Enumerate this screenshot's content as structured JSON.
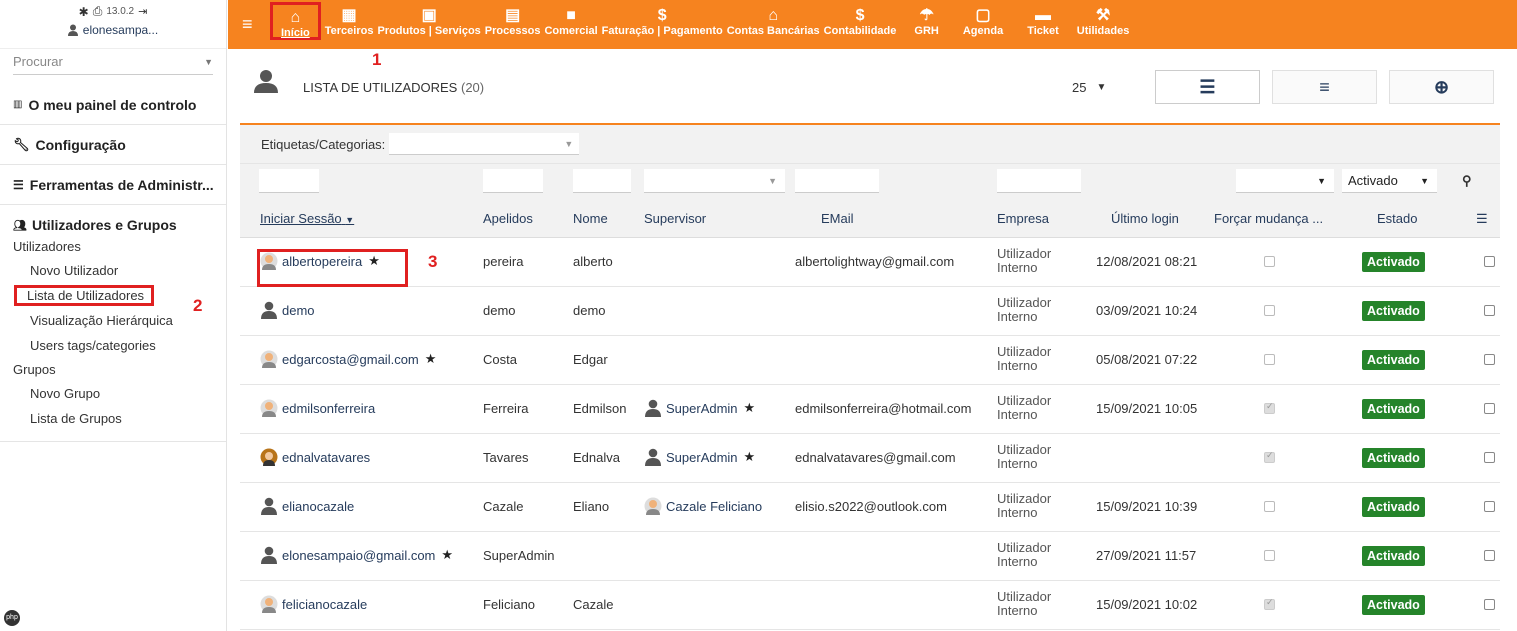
{
  "sidebar": {
    "version": "13.0.2",
    "username": "elonesampa...",
    "search_placeholder": "Procurar",
    "dashboard": "O meu painel de controlo",
    "config": "Configuração",
    "admin_tools": "Ferramentas de Administr...",
    "users_groups": "Utilizadores e Grupos",
    "users": "Utilizadores",
    "new_user": "Novo Utilizador",
    "user_list": "Lista de Utilizadores",
    "hierarchy": "Visualização Hierárquica",
    "tags": "Users tags/categories",
    "groups": "Grupos",
    "new_group": "Novo Grupo",
    "group_list": "Lista de Grupos"
  },
  "topnav": [
    {
      "label": "Início",
      "icon": "home-icon"
    },
    {
      "label": "Terceiros",
      "icon": "building-icon"
    },
    {
      "label": "Produtos | Serviços",
      "icon": "cube-icon"
    },
    {
      "label": "Processos",
      "icon": "clipboard-icon"
    },
    {
      "label": "Comercial",
      "icon": "briefcase-icon"
    },
    {
      "label": "Faturação | Pagamento",
      "icon": "dollar-icon"
    },
    {
      "label": "Contas Bancárias",
      "icon": "bank-icon"
    },
    {
      "label": "Contabilidade",
      "icon": "dollar-icon"
    },
    {
      "label": "GRH",
      "icon": "umbrella-icon"
    },
    {
      "label": "Agenda",
      "icon": "calendar-icon"
    },
    {
      "label": "Ticket",
      "icon": "ticket-icon"
    },
    {
      "label": "Utilidades",
      "icon": "wrench-icon"
    }
  ],
  "annotations": {
    "one": "1",
    "two": "2",
    "three": "3"
  },
  "page": {
    "title": "LISTA DE UTILIZADORES",
    "count": "(20)",
    "limit": "25",
    "filter_label": "Etiquetas/Categorias:",
    "status_filter": "Activado"
  },
  "columns": {
    "login": "Iniciar Sessão",
    "lastname": "Apelidos",
    "firstname": "Nome",
    "supervisor": "Supervisor",
    "email": "EMail",
    "company": "Empresa",
    "lastlogin": "Último login",
    "forcechange": "Forçar mudança ...",
    "status": "Estado"
  },
  "rows": [
    {
      "login": "albertopereira",
      "star": "★",
      "lastname": "pereira",
      "firstname": "alberto",
      "supervisor": "",
      "email": "albertolightway@gmail.com",
      "company1": "Utilizador",
      "company2": "Interno",
      "lastlogin": "12/08/2021 08:21",
      "status": "Activado",
      "force": false,
      "avatar": "male-photo"
    },
    {
      "login": "demo",
      "star": "",
      "lastname": "demo",
      "firstname": "demo",
      "supervisor": "",
      "email": "",
      "company1": "Utilizador",
      "company2": "Interno",
      "lastlogin": "03/09/2021 10:24",
      "status": "Activado",
      "force": false,
      "avatar": "generic"
    },
    {
      "login": "edgarcosta@gmail.com",
      "star": "★",
      "lastname": "Costa",
      "firstname": "Edgar",
      "supervisor": "",
      "email": "",
      "company1": "Utilizador",
      "company2": "Interno",
      "lastlogin": "05/08/2021 07:22",
      "status": "Activado",
      "force": false,
      "avatar": "male-photo"
    },
    {
      "login": "edmilsonferreira",
      "star": "",
      "lastname": "Ferreira",
      "firstname": "Edmilson",
      "supervisor": "SuperAdmin",
      "supervisor_star": "★",
      "email": "edmilsonferreira@hotmail.com",
      "company1": "Utilizador",
      "company2": "Interno",
      "lastlogin": "15/09/2021 10:05",
      "status": "Activado",
      "force": true,
      "avatar": "male-photo"
    },
    {
      "login": "ednalvatavares",
      "star": "",
      "lastname": "Tavares",
      "firstname": "Ednalva",
      "supervisor": "SuperAdmin",
      "supervisor_star": "★",
      "email": "ednalvatavares@gmail.com",
      "company1": "Utilizador",
      "company2": "Interno",
      "lastlogin": "",
      "status": "Activado",
      "force": true,
      "avatar": "female-photo"
    },
    {
      "login": "elianocazale",
      "star": "",
      "lastname": "Cazale",
      "firstname": "Eliano",
      "supervisor": "Cazale Feliciano",
      "supervisor_star": "",
      "email": "elisio.s2022@outlook.com",
      "company1": "Utilizador",
      "company2": "Interno",
      "lastlogin": "15/09/2021 10:39",
      "status": "Activado",
      "force": false,
      "avatar": "generic"
    },
    {
      "login": "elonesampaio@gmail.com",
      "star": "★",
      "lastname": "SuperAdmin",
      "firstname": "",
      "supervisor": "",
      "email": "",
      "company1": "Utilizador",
      "company2": "Interno",
      "lastlogin": "27/09/2021 11:57",
      "status": "Activado",
      "force": false,
      "avatar": "generic"
    },
    {
      "login": "felicianocazale",
      "star": "",
      "lastname": "Feliciano",
      "firstname": "Cazale",
      "supervisor": "",
      "email": "",
      "company1": "Utilizador",
      "company2": "Interno",
      "lastlogin": "15/09/2021 10:02",
      "status": "Activado",
      "force": true,
      "avatar": "male-photo"
    }
  ],
  "colors": {
    "accent": "#f6831f",
    "status_green": "#25842a",
    "link": "#263c5c",
    "highlight": "#e02020"
  }
}
